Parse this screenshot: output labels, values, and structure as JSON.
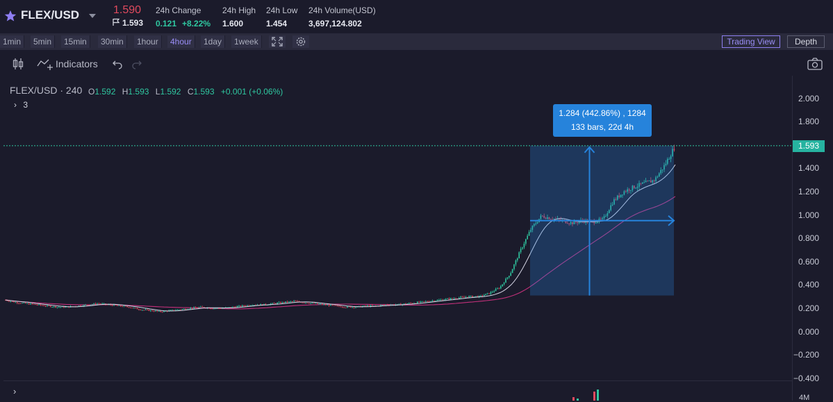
{
  "ticker": {
    "pair": "FLEX/USD",
    "last_price": "1.590",
    "sub_price": "1.593",
    "change_label": "24h Change",
    "change_abs": "0.121",
    "change_pct": "+8.22%",
    "high_label": "24h High",
    "high_value": "1.600",
    "low_label": "24h Low",
    "low_value": "1.454",
    "volume_label": "24h Volume(USD)",
    "volume_value": "3,697,124.802"
  },
  "intervals": [
    "1min",
    "5min",
    "15min",
    "30min",
    "1hour",
    "4hour",
    "1day",
    "1week"
  ],
  "active_interval": "4hour",
  "view_buttons": {
    "trading_view": "Trading View",
    "depth": "Depth"
  },
  "chart_toolbar": {
    "indicators": "Indicators"
  },
  "legend": {
    "symbol": "FLEX/USD · 240",
    "open_key": "O",
    "open": "1.592",
    "high_key": "H",
    "high": "1.593",
    "low_key": "L",
    "low": "1.592",
    "close_key": "C",
    "close": "1.593",
    "change": "+0.001 (+0.06%)",
    "studies_count": "3"
  },
  "axis": {
    "ticks": [
      "2.000",
      "1.800",
      "1.600",
      "1.400",
      "1.200",
      "1.000",
      "0.800",
      "0.600",
      "0.400",
      "0.200",
      "0.000",
      "−0.200",
      "−0.400"
    ],
    "current_price": "1.593",
    "volume_tick": "4M"
  },
  "measure": {
    "line1": "1.284 (442.86%) , 1284",
    "line2": "133 bars, 22d 4h"
  },
  "colors": {
    "up": "#2fc7a0",
    "down": "#e04a5e",
    "accent": "#9a8ef6",
    "measure": "#2683db",
    "ma_fast": "#d6d6e6",
    "ma_slow": "#c2307a"
  },
  "chart_data": {
    "type": "line",
    "title": "",
    "xlabel": "",
    "ylabel": "",
    "ylim": [
      -0.4,
      2.0
    ],
    "grid": false,
    "series": [
      {
        "values": [
          0.27,
          0.25,
          0.24,
          0.23,
          0.22,
          0.21,
          0.21,
          0.22,
          0.23,
          0.24,
          0.23,
          0.22,
          0.21,
          0.19,
          0.18,
          0.17,
          0.18,
          0.19,
          0.2,
          0.21,
          0.2,
          0.2,
          0.21,
          0.22,
          0.23,
          0.23,
          0.24,
          0.25,
          0.26,
          0.25,
          0.24,
          0.23,
          0.22,
          0.21,
          0.21,
          0.22,
          0.22,
          0.23,
          0.23,
          0.24,
          0.25,
          0.26,
          0.27,
          0.28,
          0.29,
          0.3,
          0.3,
          0.33,
          0.38,
          0.5,
          0.7,
          0.88,
          0.99,
          0.97,
          0.95,
          0.93,
          0.95,
          0.94,
          0.96,
          1.12,
          1.2,
          1.24,
          1.27,
          1.3,
          1.43,
          1.593
        ]
      }
    ],
    "measure_range": {
      "from": 0.309,
      "to": 1.593,
      "bars": 133
    }
  }
}
